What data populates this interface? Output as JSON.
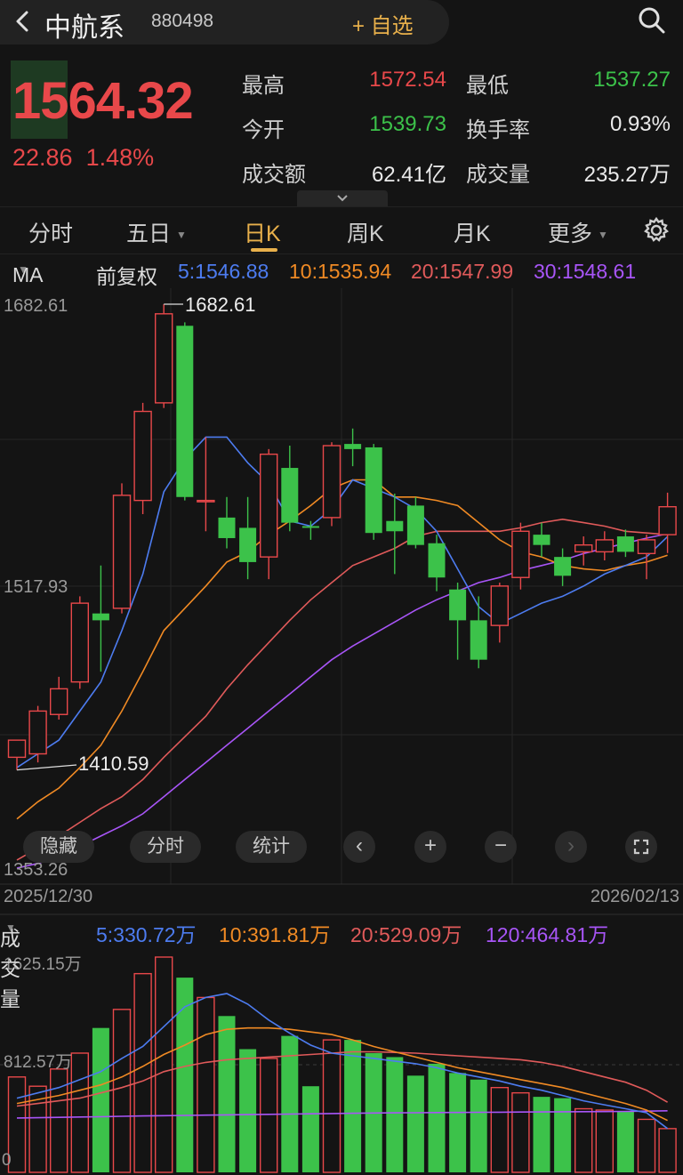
{
  "header": {
    "name": "中航系",
    "code": "880498",
    "add_watch": "+ 自选"
  },
  "quote": {
    "price": "1564.32",
    "change": "22.86",
    "change_pct": "1.48%",
    "stats": [
      {
        "label": "最高",
        "value": "1572.54",
        "color": "red"
      },
      {
        "label": "最低",
        "value": "1537.27",
        "color": "green"
      },
      {
        "label": "今开",
        "value": "1539.73",
        "color": "green"
      },
      {
        "label": "换手率",
        "value": "0.93%",
        "color": "white"
      },
      {
        "label": "成交额",
        "value": "62.41亿",
        "color": "white"
      },
      {
        "label": "成交量",
        "value": "235.27万",
        "color": "white"
      }
    ]
  },
  "tabs": [
    "分时",
    "五日",
    "日K",
    "周K",
    "月K",
    "更多"
  ],
  "active_tab": "日K",
  "ma": {
    "label": "MA",
    "adjust": "前复权",
    "ma5": "5:1546.88",
    "ma10": "10:1535.94",
    "ma20": "20:1547.99",
    "ma30": "30:1548.61"
  },
  "controls": [
    "隐藏",
    "分时",
    "统计"
  ],
  "volume": {
    "label": "成交量",
    "ma5": "5:330.72万",
    "ma10": "10:391.81万",
    "ma20": "20:529.09万",
    "ma120": "120:464.81万"
  },
  "colors": {
    "up": "#e8484a",
    "down": "#3cc24a",
    "accent": "#e8b04b",
    "ma5": "#4d7cf0",
    "ma10": "#f08a24",
    "ma20": "#e05a5a",
    "ma30": "#a855f7"
  },
  "chart_data": {
    "type": "candlestick",
    "price_axis_labels": [
      "1682.61",
      "1517.93",
      "1353.26"
    ],
    "ylim": [
      1353.26,
      1682.61
    ],
    "annotations": {
      "high": "1682.61",
      "low": "1410.59"
    },
    "date_start": "2025/12/30",
    "date_end": "2026/02/13",
    "volume_axis_labels": [
      "1625.15万",
      "812.57万",
      "0"
    ],
    "volume_ylim": [
      0,
      1625.15
    ],
    "candles": [
      {
        "o": 1418,
        "h": 1425,
        "l": 1410.59,
        "c": 1428
      },
      {
        "o": 1420,
        "h": 1448,
        "l": 1415,
        "c": 1445
      },
      {
        "o": 1443,
        "h": 1465,
        "l": 1440,
        "c": 1458
      },
      {
        "o": 1462,
        "h": 1512,
        "l": 1458,
        "c": 1508
      },
      {
        "o": 1502,
        "h": 1530,
        "l": 1468,
        "c": 1498
      },
      {
        "o": 1505,
        "h": 1578,
        "l": 1502,
        "c": 1571
      },
      {
        "o": 1568,
        "h": 1625,
        "l": 1560,
        "c": 1620
      },
      {
        "o": 1625,
        "h": 1682.61,
        "l": 1622,
        "c": 1677
      },
      {
        "o": 1670,
        "h": 1672,
        "l": 1568,
        "c": 1570
      },
      {
        "o": 1568,
        "h": 1605,
        "l": 1550,
        "c": 1568
      },
      {
        "o": 1558,
        "h": 1570,
        "l": 1540,
        "c": 1546
      },
      {
        "o": 1552,
        "h": 1570,
        "l": 1522,
        "c": 1532
      },
      {
        "o": 1535,
        "h": 1598,
        "l": 1522,
        "c": 1595
      },
      {
        "o": 1587,
        "h": 1600,
        "l": 1550,
        "c": 1555
      },
      {
        "o": 1553,
        "h": 1556,
        "l": 1545,
        "c": 1552
      },
      {
        "o": 1558,
        "h": 1602,
        "l": 1553,
        "c": 1600
      },
      {
        "o": 1601,
        "h": 1610,
        "l": 1588,
        "c": 1598
      },
      {
        "o": 1599,
        "h": 1601,
        "l": 1545,
        "c": 1549
      },
      {
        "o": 1556,
        "h": 1572,
        "l": 1525,
        "c": 1550
      },
      {
        "o": 1565,
        "h": 1570,
        "l": 1540,
        "c": 1542
      },
      {
        "o": 1543,
        "h": 1548,
        "l": 1515,
        "c": 1523
      },
      {
        "o": 1516,
        "h": 1520,
        "l": 1475,
        "c": 1498
      },
      {
        "o": 1498,
        "h": 1512,
        "l": 1470,
        "c": 1475
      },
      {
        "o": 1495,
        "h": 1520,
        "l": 1485,
        "c": 1518
      },
      {
        "o": 1523,
        "h": 1555,
        "l": 1516,
        "c": 1550
      },
      {
        "o": 1548,
        "h": 1555,
        "l": 1535,
        "c": 1542
      },
      {
        "o": 1535,
        "h": 1540,
        "l": 1518,
        "c": 1524
      },
      {
        "o": 1538,
        "h": 1547,
        "l": 1530,
        "c": 1542
      },
      {
        "o": 1538,
        "h": 1550,
        "l": 1533,
        "c": 1545
      },
      {
        "o": 1547,
        "h": 1551,
        "l": 1535,
        "c": 1538
      },
      {
        "o": 1537,
        "h": 1548,
        "l": 1522,
        "c": 1545
      },
      {
        "o": 1548,
        "h": 1572.54,
        "l": 1537.27,
        "c": 1564.32
      }
    ],
    "ma5_line": [
      1412,
      1420,
      1428,
      1445,
      1462,
      1492,
      1525,
      1573,
      1592,
      1605,
      1605,
      1590,
      1578,
      1556,
      1553,
      1563,
      1580,
      1575,
      1570,
      1563,
      1550,
      1528,
      1506,
      1496,
      1502,
      1508,
      1512,
      1518,
      1525,
      1530,
      1535,
      1546.88
    ],
    "ma10_line": [
      1382,
      1392,
      1400,
      1412,
      1425,
      1445,
      1468,
      1492,
      1505,
      1518,
      1532,
      1538,
      1548,
      1556,
      1565,
      1575,
      1580,
      1580,
      1570,
      1570,
      1568,
      1565,
      1555,
      1545,
      1538,
      1535,
      1530,
      1528,
      1527,
      1530,
      1532,
      1535.94
    ],
    "ma20_line": [
      1358,
      1365,
      1372,
      1380,
      1388,
      1395,
      1405,
      1418,
      1430,
      1442,
      1458,
      1472,
      1485,
      1498,
      1510,
      1520,
      1530,
      1535,
      1540,
      1547,
      1550,
      1550,
      1550,
      1550,
      1552,
      1555,
      1557,
      1555,
      1553,
      1550,
      1549,
      1547.99
    ],
    "ma30_line": [
      1353.26,
      1356,
      1360,
      1366,
      1372,
      1378,
      1385,
      1395,
      1405,
      1415,
      1425,
      1435,
      1445,
      1455,
      1465,
      1475,
      1483,
      1490,
      1497,
      1504,
      1510,
      1515,
      1520,
      1523,
      1527,
      1530,
      1533,
      1537,
      1540,
      1543,
      1546,
      1548.61
    ],
    "volumes": [
      720,
      650,
      780,
      900,
      1090,
      1230,
      1500,
      1625.15,
      1470,
      1320,
      1180,
      930,
      860,
      1030,
      650,
      1000,
      1000,
      900,
      870,
      730,
      820,
      750,
      700,
      640,
      600,
      570,
      560,
      480,
      470,
      460,
      400,
      330
    ],
    "vol_ma5_line": [
      560,
      600,
      640,
      700,
      760,
      860,
      950,
      1100,
      1250,
      1320,
      1350,
      1270,
      1150,
      1050,
      960,
      900,
      880,
      860,
      840,
      820,
      790,
      750,
      720,
      690,
      650,
      620,
      580,
      540,
      510,
      480,
      450,
      330.72
    ],
    "vol_ma10_line": [
      520,
      550,
      580,
      620,
      660,
      720,
      800,
      890,
      960,
      1040,
      1080,
      1090,
      1090,
      1080,
      1060,
      1040,
      1000,
      950,
      910,
      870,
      830,
      790,
      760,
      730,
      700,
      670,
      640,
      600,
      560,
      520,
      470,
      391.81
    ],
    "vol_ma20_line": [
      500,
      520,
      540,
      560,
      600,
      640,
      690,
      760,
      800,
      830,
      850,
      860,
      870,
      880,
      890,
      900,
      910,
      910,
      905,
      900,
      890,
      880,
      870,
      860,
      850,
      830,
      800,
      760,
      720,
      680,
      620,
      529.09
    ],
    "vol_ma120_line": [
      410,
      412,
      415,
      418,
      420,
      423,
      426,
      428,
      430,
      432,
      434,
      436,
      438,
      440,
      442,
      444,
      446,
      448,
      449,
      450,
      451,
      452,
      453,
      454,
      455,
      456,
      457,
      458,
      459,
      460,
      462,
      464.81
    ]
  }
}
